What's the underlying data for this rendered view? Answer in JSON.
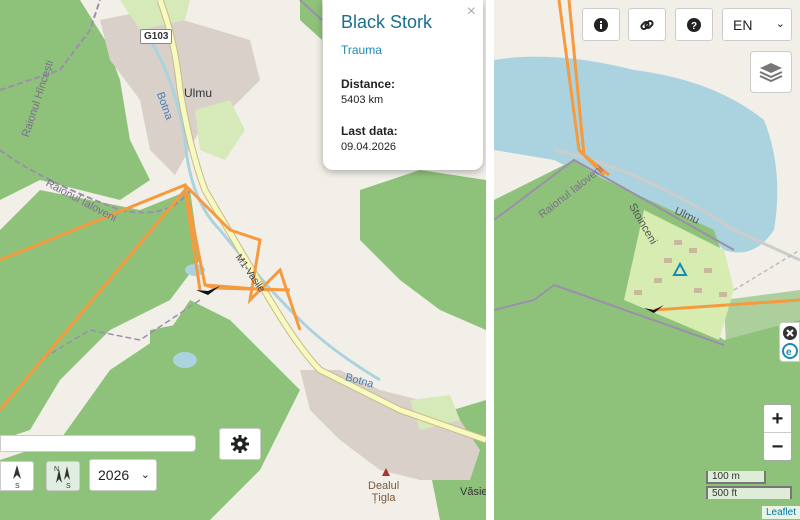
{
  "popup": {
    "title": "Black Stork",
    "status": "Trauma",
    "distance_label": "Distance:",
    "distance_value": "5403 km",
    "last_data_label": "Last data:",
    "last_data_value": "09.04.2026",
    "close_glyph": "×"
  },
  "left_map": {
    "road_shield": "G103",
    "place_ulmu": "Ulmu",
    "region_hincesti": "Raionul Hîncești",
    "region_ialoveni": "Raionul Ialoveni",
    "river_botna_1": "Botna",
    "river_botna_2": "Botna",
    "road_m1": "M1-Vasile",
    "peak_name": "Dealul\nȚigla",
    "village_vasie": "Văsie",
    "bird_icon": "bird-track-marker"
  },
  "right_map": {
    "region_ialoveni": "Raionul Ialoveni",
    "place_stoinceni": "Stoinceni",
    "place_ulmu": "Ulmu",
    "camp_icon": "campsite-icon"
  },
  "controls": {
    "year_value": "2026",
    "lang_value": "EN",
    "dir_south_label": "S",
    "dir_north_label": "N",
    "dir_south2_label": "S",
    "zoom_in": "+",
    "zoom_out": "−",
    "scale_metric": "100 m",
    "scale_imperial": "500 ft",
    "attribution": "Leaflet"
  },
  "colors": {
    "forest": "#8ec27a",
    "land": "#f2efe9",
    "water": "#aad3df",
    "track": "#f59a3e",
    "urban": "#d9d0c9",
    "road": "#f7fabf",
    "link": "#1a6e8e"
  }
}
